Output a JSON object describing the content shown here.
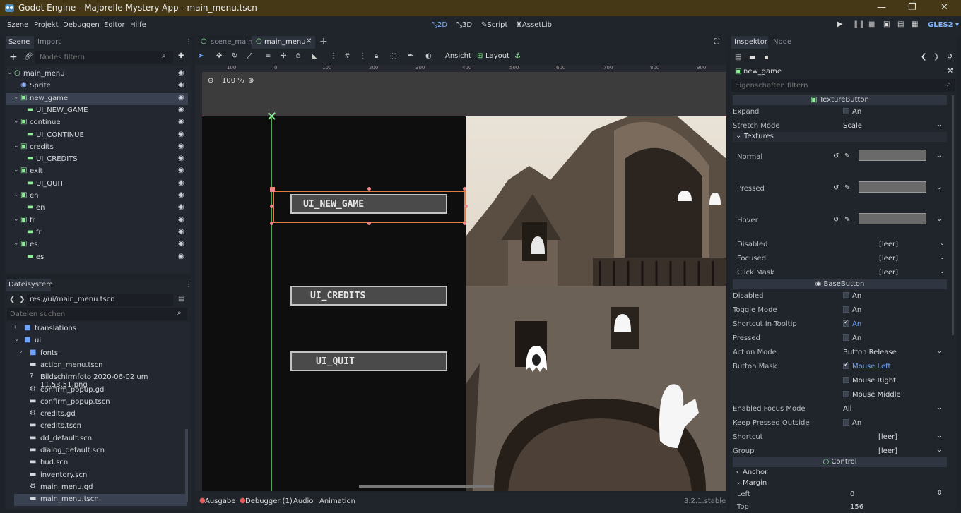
{
  "window": {
    "title": "Godot Engine - Majorelle Mystery App - main_menu.tscn"
  },
  "menu": [
    "Szene",
    "Projekt",
    "Debuggen",
    "Editor",
    "Hilfe"
  ],
  "modes": [
    {
      "label": "2D",
      "active": true
    },
    {
      "label": "3D"
    },
    {
      "label": "Script"
    },
    {
      "label": "AssetLib"
    }
  ],
  "renderer": "GLES2",
  "scene_dock": {
    "tabs": [
      "Szene",
      "Import"
    ],
    "filter_placeholder": "Nodes filtern",
    "nodes": [
      {
        "label": "main_menu",
        "depth": 0
      },
      {
        "label": "Sprite",
        "depth": 1
      },
      {
        "label": "new_game",
        "depth": 1,
        "selected": true
      },
      {
        "label": "UI_NEW_GAME",
        "depth": 2
      },
      {
        "label": "continue",
        "depth": 1
      },
      {
        "label": "UI_CONTINUE",
        "depth": 2
      },
      {
        "label": "credits",
        "depth": 1
      },
      {
        "label": "UI_CREDITS",
        "depth": 2
      },
      {
        "label": "exit",
        "depth": 1
      },
      {
        "label": "UI_QUIT",
        "depth": 2
      },
      {
        "label": "en",
        "depth": 1
      },
      {
        "label": "en",
        "depth": 2
      },
      {
        "label": "fr",
        "depth": 1
      },
      {
        "label": "fr",
        "depth": 2
      },
      {
        "label": "es",
        "depth": 1
      },
      {
        "label": "es",
        "depth": 2
      }
    ]
  },
  "filesystem": {
    "tab": "Dateisystem",
    "path": "res://ui/main_menu.tscn",
    "search_placeholder": "Dateien suchen",
    "items": [
      {
        "label": "translations",
        "kind": "folder",
        "indent": 0
      },
      {
        "label": "ui",
        "kind": "folder",
        "indent": 0
      },
      {
        "label": "fonts",
        "kind": "folder",
        "indent": 1
      },
      {
        "label": "action_menu.tscn",
        "kind": "scene",
        "indent": 1
      },
      {
        "label": "Bildschirmfoto 2020-06-02 um 11.53.51.png",
        "kind": "file",
        "indent": 1
      },
      {
        "label": "confirm_popup.gd",
        "kind": "script",
        "indent": 1
      },
      {
        "label": "confirm_popup.tscn",
        "kind": "scene",
        "indent": 1
      },
      {
        "label": "credits.gd",
        "kind": "script",
        "indent": 1
      },
      {
        "label": "credits.tscn",
        "kind": "scene",
        "indent": 1
      },
      {
        "label": "dd_default.scn",
        "kind": "scene",
        "indent": 1
      },
      {
        "label": "dialog_default.scn",
        "kind": "scene",
        "indent": 1
      },
      {
        "label": "hud.scn",
        "kind": "scene",
        "indent": 1
      },
      {
        "label": "inventory.scn",
        "kind": "scene",
        "indent": 1
      },
      {
        "label": "main_menu.gd",
        "kind": "script",
        "indent": 1
      },
      {
        "label": "main_menu.tscn",
        "kind": "scene",
        "indent": 1,
        "selected": true
      }
    ]
  },
  "editor": {
    "tabs": [
      "scene_main",
      "main_menu"
    ],
    "toolbar": {
      "view_label": "Ansicht",
      "layout_label": "Layout"
    },
    "zoom": "100 %",
    "ruler_ticks": [
      "100",
      "0",
      "100",
      "200",
      "300",
      "400",
      "500",
      "600",
      "700",
      "800",
      "900"
    ],
    "buttons": [
      "UI_NEW_GAME",
      "UI_CREDITS",
      "UI_QUIT"
    ]
  },
  "bottom": {
    "tabs": [
      "Ausgabe",
      "Debugger (1)",
      "Audio",
      "Animation"
    ],
    "version": "3.2.1.stable"
  },
  "inspector": {
    "tabs": [
      "Inspektor",
      "Node"
    ],
    "node_name": "new_game",
    "filter_placeholder": "Eigenschaften filtern",
    "sections": {
      "texture_button": "TextureButton",
      "textures": "Textures",
      "base_button": "BaseButton",
      "control": "Control",
      "anchor": "Anchor",
      "margin": "Margin"
    },
    "expand": {
      "label": "Expand",
      "value": "An"
    },
    "stretch_mode": {
      "label": "Stretch Mode",
      "value": "Scale"
    },
    "tex_normal": "Normal",
    "tex_pressed": "Pressed",
    "tex_hover": "Hover",
    "tex_disabled": {
      "label": "Disabled",
      "value": "[leer]"
    },
    "tex_focused": {
      "label": "Focused",
      "value": "[leer]"
    },
    "tex_click_mask": {
      "label": "Click Mask",
      "value": "[leer]"
    },
    "disabled": {
      "label": "Disabled",
      "value": "An"
    },
    "toggle_mode": {
      "label": "Toggle Mode",
      "value": "An"
    },
    "shortcut_tooltip": {
      "label": "Shortcut In Tooltip",
      "value": "An"
    },
    "pressed": {
      "label": "Pressed",
      "value": "An"
    },
    "action_mode": {
      "label": "Action Mode",
      "value": "Button Release"
    },
    "button_mask": {
      "label": "Button Mask",
      "left": "Mouse Left",
      "right": "Mouse Right",
      "middle": "Mouse Middle"
    },
    "focus_mode": {
      "label": "Enabled Focus Mode",
      "value": "All"
    },
    "keep_pressed": {
      "label": "Keep Pressed Outside",
      "value": "An"
    },
    "shortcut": {
      "label": "Shortcut",
      "value": "[leer]"
    },
    "group": {
      "label": "Group",
      "value": "[leer]"
    },
    "margin_left": {
      "label": "Left",
      "value": "0"
    },
    "margin_top": {
      "label": "Top",
      "value": "156"
    }
  },
  "colors": {
    "accent": "#6ea3ff",
    "title_bar": "#443817",
    "selection": "#e07b3c",
    "node_green": "#8eef97"
  }
}
